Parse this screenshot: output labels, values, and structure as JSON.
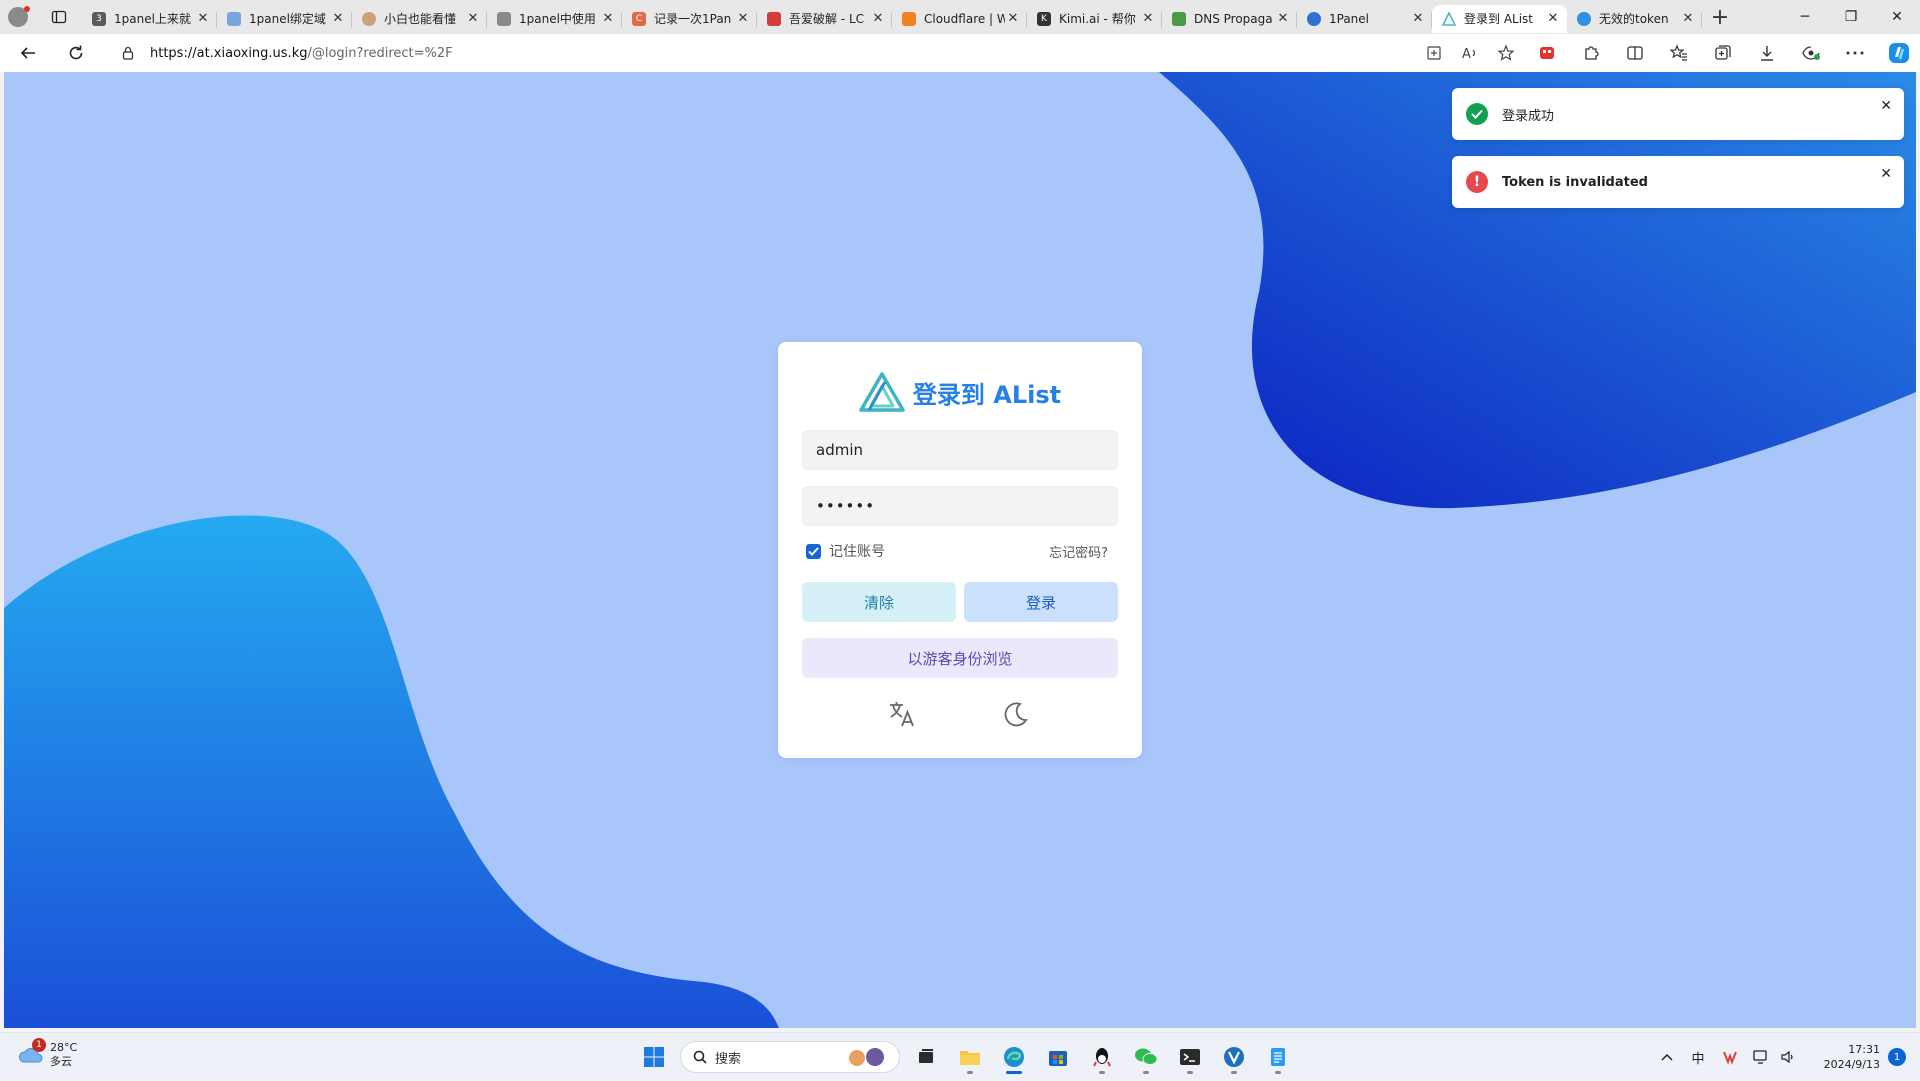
{
  "browser": {
    "tabs": [
      {
        "title": "1panel上来就",
        "color": "#5a5a5a",
        "glyph": "3"
      },
      {
        "title": "1panel绑定域",
        "color": "#7aa3e0",
        "glyph": "q"
      },
      {
        "title": "小白也能看懂",
        "color": "#c9a27a",
        "glyph": ""
      },
      {
        "title": "1panel中使用",
        "color": "#8a8a8a",
        "glyph": ""
      },
      {
        "title": "记录一次1Pan",
        "color": "#e06a4a",
        "glyph": "C"
      },
      {
        "title": "吾爱破解 - LC",
        "color": "#d43c3c",
        "glyph": ""
      },
      {
        "title": "Cloudflare | W",
        "color": "#f48120",
        "glyph": ""
      },
      {
        "title": "Kimi.ai - 帮你",
        "color": "#333333",
        "glyph": "K"
      },
      {
        "title": "DNS Propaga",
        "color": "#4a9a4a",
        "glyph": ""
      },
      {
        "title": "1Panel",
        "color": "#2f6fd6",
        "glyph": ""
      },
      {
        "title": "登录到 AList",
        "color": "#4ab7c9",
        "glyph": "",
        "active": true
      },
      {
        "title": "无效的token",
        "color": "#2f8fe6",
        "glyph": ""
      }
    ],
    "url_host": "https://at.xiaoxing.us.kg",
    "url_rest": "/@login?redirect=%2F"
  },
  "login": {
    "heading": "登录到 AList",
    "username_value": "admin",
    "password_value": "••••••",
    "remember_label": "记住账号",
    "remember_checked": true,
    "forgot_label": "忘记密码?",
    "clear_label": "清除",
    "login_label": "登录",
    "guest_label": "以游客身份浏览",
    "colors": {
      "heading": "#2481e6",
      "accent": "#1565d8"
    }
  },
  "toasts": [
    {
      "message": "登录成功",
      "status": "success",
      "color": "#12a150"
    },
    {
      "message": "Token is invalidated",
      "status": "error",
      "color": "#e5484d"
    }
  ],
  "taskbar": {
    "weather_temp": "28°C",
    "weather_desc": "多云",
    "weather_badge": "1",
    "search_placeholder": "搜索",
    "time": "17:31",
    "date": "2024/9/13",
    "notification_count": "1",
    "input_method": "中"
  }
}
